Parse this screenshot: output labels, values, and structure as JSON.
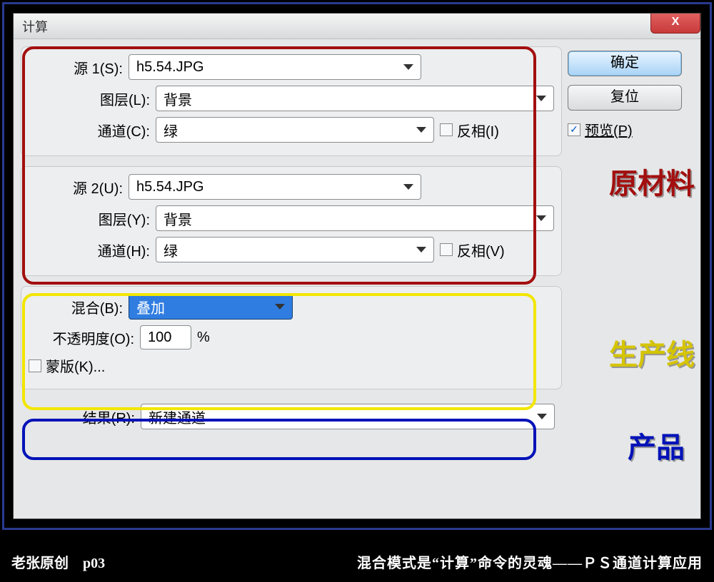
{
  "dialog": {
    "title": "计算",
    "close_glyph": "X"
  },
  "source1": {
    "label": "源 1(S):",
    "value": "h5.54.JPG",
    "layer_label": "图层(L):",
    "layer_value": "背景",
    "channel_label": "通道(C):",
    "channel_value": "绿",
    "invert_label": "反相(I)"
  },
  "source2": {
    "label": "源 2(U):",
    "value": "h5.54.JPG",
    "layer_label": "图层(Y):",
    "layer_value": "背景",
    "channel_label": "通道(H):",
    "channel_value": "绿",
    "invert_label": "反相(V)"
  },
  "blend": {
    "label": "混合(B):",
    "value": "叠加",
    "opacity_label": "不透明度(O):",
    "opacity_value": "100",
    "opacity_suffix": "%",
    "mask_label": "蒙版(K)..."
  },
  "result": {
    "label": "结果(R):",
    "value": "新建通道"
  },
  "buttons": {
    "ok": "确定",
    "reset": "复位",
    "preview": "预览(P)",
    "preview_checked": "✓"
  },
  "annotations": {
    "raw": "原材料",
    "line": "生产线",
    "product": "产品"
  },
  "footer": {
    "left_author": "老张原创",
    "left_page": "p03",
    "right": "混合模式是“计算”命令的灵魂——ＰＳ通道计算应用"
  }
}
